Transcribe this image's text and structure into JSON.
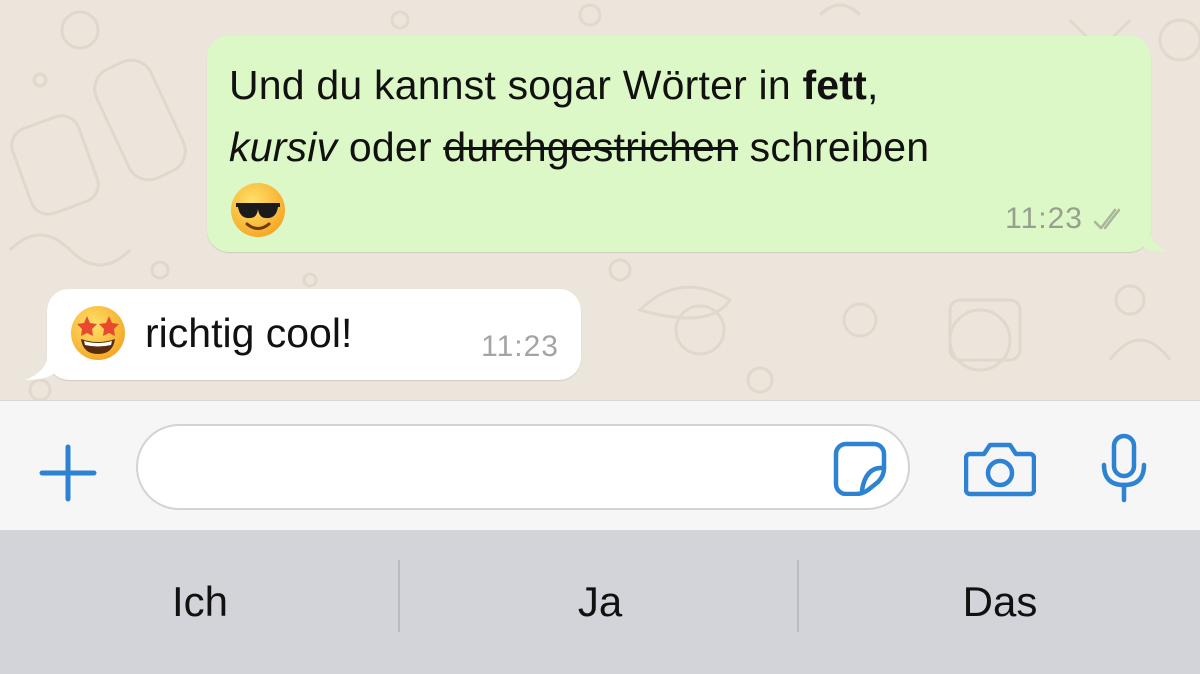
{
  "chat": {
    "outgoing_message": {
      "part1": "Und du kannst sogar Wörter in ",
      "bold": "fett",
      "part2": ",",
      "italic": "kursiv",
      "part3": " oder ",
      "strikethrough": "durchgestrichen",
      "part4": " schreiben",
      "emoji": "smiling-face-with-sunglasses",
      "time": "11:23",
      "status": "read-checkmarks"
    },
    "incoming_message": {
      "emoji": "star-struck",
      "text": "richtig cool!",
      "time": "11:23"
    }
  },
  "input_bar": {
    "plus_icon": "plus-icon",
    "field_value": "",
    "sticker_icon": "sticker-icon",
    "camera_icon": "camera-icon",
    "mic_icon": "microphone-icon",
    "accent_color": "#2d82d1"
  },
  "suggestions": [
    "Ich",
    "Ja",
    "Das"
  ],
  "colors": {
    "outgoing_bubble": "#dcf8c6",
    "incoming_bubble": "#ffffff",
    "chat_background": "#ece5dc",
    "suggestion_bar": "#d2d4da"
  }
}
